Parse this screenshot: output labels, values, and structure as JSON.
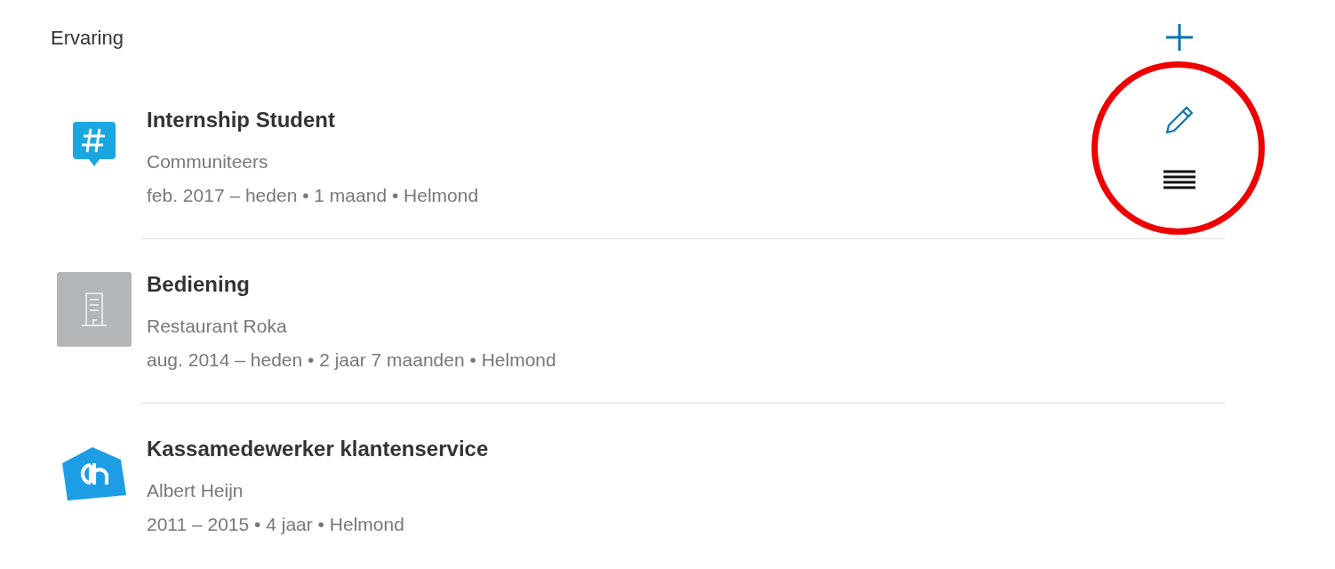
{
  "section": {
    "title": "Ervaring"
  },
  "positions": [
    {
      "kind": "hashtag",
      "title": "Internship Student",
      "company": "Communiteers",
      "details": "feb. 2017 – heden • 1 maand • Helmond",
      "show_controls": true
    },
    {
      "kind": "building",
      "title": "Bediening",
      "company": "Restaurant Roka",
      "details": "aug. 2014 – heden • 2 jaar 7 maanden • Helmond",
      "show_controls": false
    },
    {
      "kind": "store",
      "title": "Kassamedewerker klantenservice",
      "company": "Albert Heijn",
      "details": "2011 – 2015 • 4 jaar • Helmond",
      "show_controls": false
    }
  ]
}
